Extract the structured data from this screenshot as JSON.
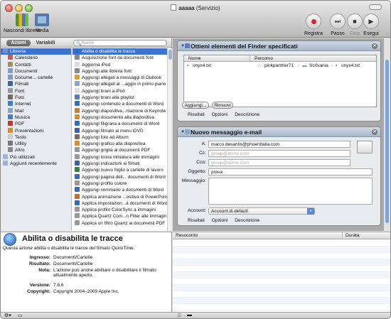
{
  "window": {
    "title": "aaaaa",
    "title_suffix": "(Servizio)"
  },
  "toolbar": {
    "hide_library": "Nascondi libreria",
    "media": "Media",
    "record": "Registra",
    "step": "Passo",
    "stop": "Stop",
    "run": "Esegui"
  },
  "library": {
    "tabs": {
      "actions": "Azioni",
      "variables": "Variabili"
    },
    "search_placeholder": "Nome",
    "categories": [
      {
        "label": "Libreria",
        "color": "#6b8fd6"
      },
      {
        "label": "Calendario",
        "color": "#d9534f"
      },
      {
        "label": "Contatti",
        "color": "#b58a52"
      },
      {
        "label": "Documenti",
        "color": "#7f9fc6"
      },
      {
        "label": "Docume... cartelle",
        "color": "#7a9cc9"
      },
      {
        "label": "Filmati",
        "color": "#3c5fa8"
      },
      {
        "label": "Font",
        "color": "#999999"
      },
      {
        "label": "Foto",
        "color": "#7a6b5a"
      },
      {
        "label": "Internet",
        "color": "#3b82c4"
      },
      {
        "label": "Mail",
        "color": "#8aa5c8"
      },
      {
        "label": "Musica",
        "color": "#4a7bd0"
      },
      {
        "label": "PDF",
        "color": "#c0392b"
      },
      {
        "label": "Presentazioni",
        "color": "#e08a2b"
      },
      {
        "label": "Testo",
        "color": "#cccccc"
      },
      {
        "label": "Utility",
        "color": "#777777"
      },
      {
        "label": "Altro",
        "color": "#888888"
      },
      {
        "label": "Più utilizzati",
        "color": "#9db3d3"
      },
      {
        "label": "Aggiunti recentemente",
        "color": "#9db3d3"
      }
    ],
    "actions": [
      {
        "label": "Abilita o disabilita le tracce",
        "color": "#2f6fc2"
      },
      {
        "label": "Acquisizione font da documenti font",
        "color": "#888888"
      },
      {
        "label": "Aggiorna iPod",
        "color": "#dddddd"
      },
      {
        "label": "Aggiungi alla libreria font",
        "color": "#888888"
      },
      {
        "label": "Aggiungi allegati a messaggi di Outlook",
        "color": "#e0a020"
      },
      {
        "label": "Aggiungi allegati al ...aggio in primo piano",
        "color": "#8aa5c8"
      },
      {
        "label": "Aggiungi brani a iPod",
        "color": "#dddddd"
      },
      {
        "label": "Aggiungi brani alla playlist",
        "color": "#4a7bd0"
      },
      {
        "label": "Aggiungi contenuto a documenti di Word",
        "color": "#2f6fc2"
      },
      {
        "label": "Aggiungi diapositiva...ntazione di Keynote",
        "color": "#c08040"
      },
      {
        "label": "Aggiungi documento alla diapositiva",
        "color": "#e08a2b"
      },
      {
        "label": "Aggiungi filigrana a documenti di Word",
        "color": "#2f6fc2"
      },
      {
        "label": "Aggiungi filmato al menu iDVD",
        "color": "#3c5fa8"
      },
      {
        "label": "Aggiungi foto ad Album",
        "color": "#7a6b5a"
      },
      {
        "label": "Aggiungi grafico alla diapositiva",
        "color": "#e08a2b"
      },
      {
        "label": "Aggiungi griglia ai documenti PDF",
        "color": "#999999"
      },
      {
        "label": "Aggiungi icona miniatura alle immagini",
        "color": "#999999"
      },
      {
        "label": "Aggiungi indicazioni ai filmati",
        "color": "#3c5fa8"
      },
      {
        "label": "Aggiungi nuovo foglio a cartelle di lavoro",
        "color": "#2e8b3a"
      },
      {
        "label": "Aggiungi pagina dell... documenti di Word",
        "color": "#2f6fc2"
      },
      {
        "label": "Aggiungi profilo colore",
        "color": "#999999"
      },
      {
        "label": "Aggiungi sommario a documenti di Word",
        "color": "#2f6fc2"
      },
      {
        "label": "Applica animazione ...ositiva di PowerPoint",
        "color": "#d2691e"
      },
      {
        "label": "Applica impostazion...a documenti di Word",
        "color": "#2f6fc2"
      },
      {
        "label": "Applica profilo ColorSync a immagini",
        "color": "#999999"
      },
      {
        "label": "Applica Quartz Com...n Filter alle immagini",
        "color": "#999999"
      },
      {
        "label": "Applica un filtro Quartz ai documenti PDF",
        "color": "#999999"
      }
    ]
  },
  "description": {
    "title": "Abilita o disabilita le tracce",
    "text": "Questa azione abilita o disabilita le tracce del filmato QuickTime.",
    "input_key": "Ingresso:",
    "input_val": "Documenti/Cartelle",
    "result_key": "Risultato:",
    "result_val": "Documenti/Cartelle",
    "note_key": "Nota:",
    "note_val": "L'azione può anche abilitare o disabilitare il filmato attualmente aperto.",
    "version_key": "Versione:",
    "version_val": "7.6.6",
    "copyright_key": "Copyright:",
    "copyright_val": "Copyright 2004–2009 Apple Inc."
  },
  "finder_action": {
    "title": "Ottieni elementi del Finder specificati",
    "col_name": "Nome",
    "col_path": "Percorso",
    "row_name": "onyx4.txt",
    "path_user": "pinkpanther71",
    "path_folder": "Scrivania",
    "path_file": "onyx4.txt",
    "add_button": "Aggiungi...",
    "remove_button": "Rimuovi",
    "tab_results": "Risultati",
    "tab_options": "Opzioni",
    "tab_description": "Descrizione"
  },
  "mail_action": {
    "title": "Nuovo messaggio e-mail",
    "to_label": "A:",
    "to_value": "marco.desantis@phoenitalia.com",
    "cc_label": "Cc:",
    "cc_placeholder": "group@acme.com",
    "bcc_label": "Ccn:",
    "bcc_placeholder": "group@acme.com",
    "subject_label": "Oggetto:",
    "subject_value": "prova",
    "message_label": "Messaggio:",
    "account_label": "Account:",
    "account_value": "Account di default",
    "tab_results": "Risultati",
    "tab_options": "Opzioni",
    "tab_description": "Descrizione"
  },
  "log": {
    "col_report": "Resoconto",
    "col_duration": "Durata"
  }
}
